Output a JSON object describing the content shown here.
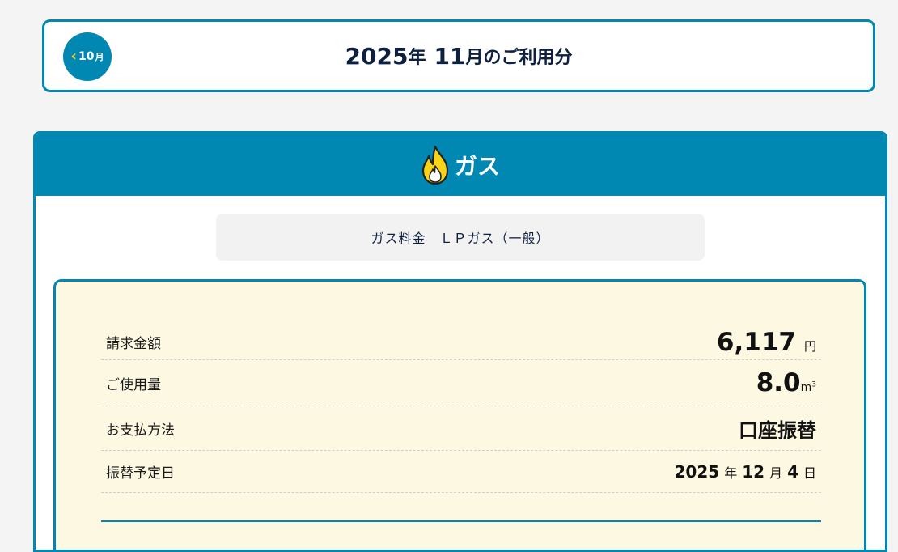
{
  "month_nav": {
    "prev_chevron": "‹",
    "prev_month_number": "10",
    "prev_month_unit": "月",
    "title_year": "2025",
    "title_year_unit": "年",
    "title_month": "11",
    "title_suffix": "月のご利用分"
  },
  "gas": {
    "icon": "flame-icon",
    "title": "ガス",
    "plan_label": "ガス料金　ＬＰガス（一般）"
  },
  "details": {
    "billing_amount": {
      "label": "請求金額",
      "value": "6,117",
      "unit": "円"
    },
    "usage": {
      "label": "ご使用量",
      "value": "8.0",
      "unit": "m",
      "unit_sup": "3"
    },
    "payment_method": {
      "label": "お支払方法",
      "value": "口座振替"
    },
    "transfer_date": {
      "label": "振替予定日",
      "year": "2025",
      "year_unit": "年",
      "month": "12",
      "month_unit": "月",
      "day": "4",
      "day_unit": "日"
    }
  },
  "colors": {
    "brand": "#0088b3",
    "accent_yellow": "#f3cb33",
    "detail_background": "#fdf8e2",
    "title_navy": "#0e2040"
  }
}
